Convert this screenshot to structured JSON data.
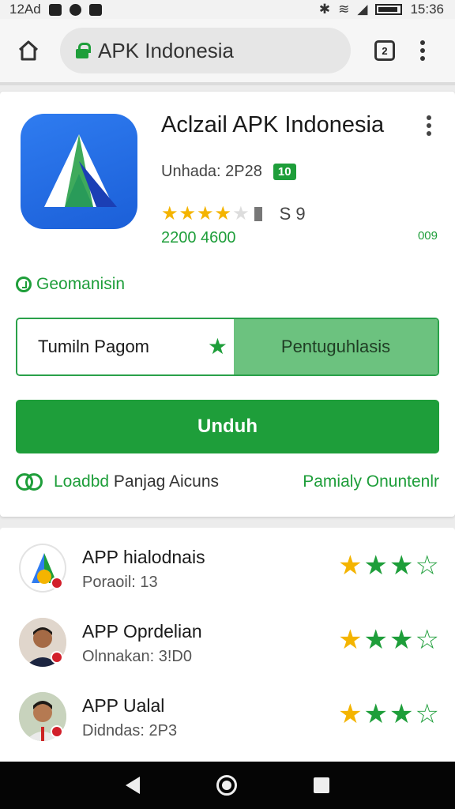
{
  "status_bar": {
    "time_left": "12Ad",
    "time_right": "15:36"
  },
  "browser": {
    "url": "APK Indonesia",
    "tab_count": "2"
  },
  "app": {
    "title": "Aclzail APK Indonesia",
    "update_label": "Unhada: 2P28",
    "update_badge": "10",
    "rating": 4,
    "rating_count": "S 9",
    "downloads": "2200 4600",
    "downloads_right": "009",
    "genre": "Geomanisin",
    "toggle_left": "Tumiln Pagom",
    "toggle_right": "Pentuguhlasis",
    "download_button": "Unduh",
    "link_left_green": "Loadbd",
    "link_left_rest": " Panjag Aicuns",
    "link_right": "Pamialy Onuntenlr"
  },
  "reviews": [
    {
      "name": "APP hialodnais",
      "sub": "Poraoil: 13",
      "stars": 4
    },
    {
      "name": "APP Oprdelian",
      "sub": "Olnnakan: 3!D0",
      "stars": 4
    },
    {
      "name": "APP Ualal",
      "sub": "Didndas: 2P3",
      "stars": 4
    }
  ],
  "colors": {
    "accent": "#1e9e3a",
    "star": "#f4b400",
    "icon_bg": "#2f7cf0"
  }
}
